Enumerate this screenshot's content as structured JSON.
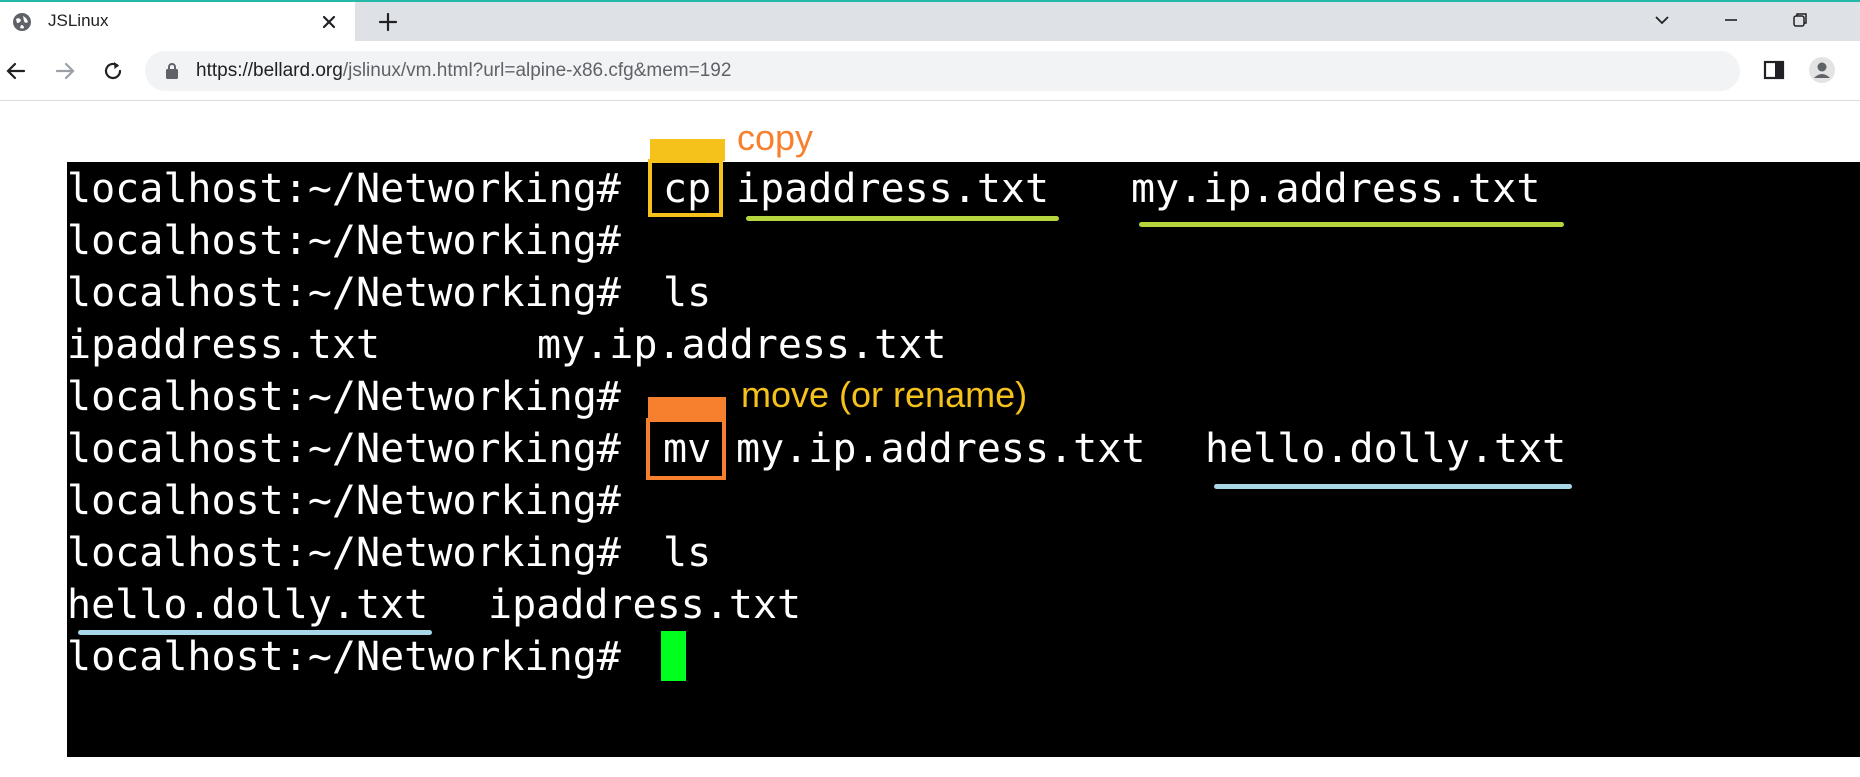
{
  "browser": {
    "tab_title": "JSLinux",
    "url_host": "https://bellard.org",
    "url_path": "/jslinux/vm.html?url=alpine-x86.cfg&mem=192"
  },
  "terminal": {
    "prompt": "localhost:~/Networking#",
    "lines": [
      {
        "prompt": "localhost:~/Networking#",
        "cmd": "cp",
        "arg1": "ipaddress.txt",
        "arg2": "my.ip.address.txt"
      },
      {
        "prompt": "localhost:~/Networking#"
      },
      {
        "prompt": "localhost:~/Networking#",
        "cmd": "ls"
      },
      {
        "out1": "ipaddress.txt",
        "out2": "my.ip.address.txt"
      },
      {
        "prompt": "localhost:~/Networking#"
      },
      {
        "prompt": "localhost:~/Networking#",
        "cmd": "mv",
        "arg1": "my.ip.address.txt",
        "arg2": "hello.dolly.txt"
      },
      {
        "prompt": "localhost:~/Networking#"
      },
      {
        "prompt": "localhost:~/Networking#",
        "cmd": "ls"
      },
      {
        "out1": "hello.dolly.txt",
        "out2": "ipaddress.txt"
      },
      {
        "prompt": "localhost:~/Networking#"
      }
    ]
  },
  "annotations": {
    "copy_label": "copy",
    "move_label": "move (or rename)"
  },
  "colors": {
    "cp_box": "#f5c21b",
    "mv_box": "#f7802e",
    "copy_text": "#f7802e",
    "move_text": "#f5c21b",
    "cp_underline": "#b5d63d",
    "mv_underline": "#a8d8e8",
    "cursor": "#00ff1f",
    "terminal_bg": "#000000",
    "terminal_fg": "#ffffff"
  },
  "icons": {
    "favicon": "globe-icon",
    "tab_close": "close-icon",
    "new_tab": "plus-icon",
    "back": "back-arrow-icon",
    "forward": "forward-arrow-icon",
    "reload": "reload-icon",
    "lock": "lock-icon",
    "side_panel": "side-panel-icon",
    "profile": "profile-icon",
    "tab_search": "chevron-down-icon",
    "minimize": "minimize-icon",
    "restore": "restore-icon"
  }
}
